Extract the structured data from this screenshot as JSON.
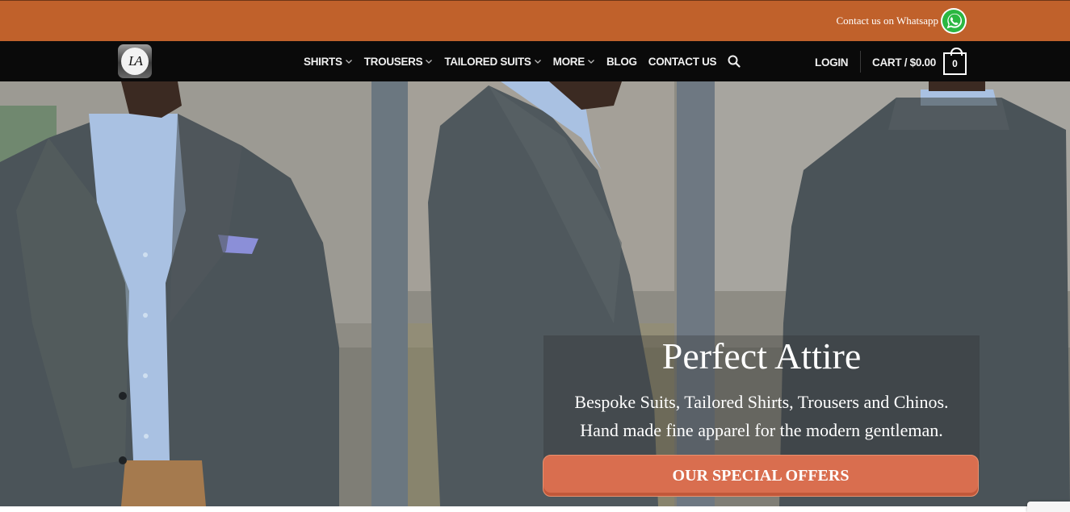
{
  "topbar": {
    "whatsapp_text": "Contact us on Whatsapp",
    "whatsapp_icon": "whatsapp-icon",
    "bg_color": "#c0612b"
  },
  "nav": {
    "logo_text": "LA",
    "items": [
      {
        "label": "SHIRTS",
        "dropdown": true
      },
      {
        "label": "TROUSERS",
        "dropdown": true
      },
      {
        "label": "TAILORED SUITS",
        "dropdown": true
      },
      {
        "label": "MORE",
        "dropdown": true
      },
      {
        "label": "BLOG",
        "dropdown": false
      },
      {
        "label": "CONTACT US",
        "dropdown": false
      }
    ],
    "search_icon": "search-icon",
    "login_label": "LOGIN",
    "cart_label": "CART / $0.00",
    "cart_count": "0"
  },
  "hero": {
    "title": "Perfect Attire",
    "subtitle_line1": "Bespoke Suits, Tailored Shirts, Trousers and Chinos.",
    "subtitle_line2": "Hand made fine apparel for the modern gentleman.",
    "cta_label": "OUR SPECIAL OFFERS",
    "cta_color": "#d96e4f"
  }
}
